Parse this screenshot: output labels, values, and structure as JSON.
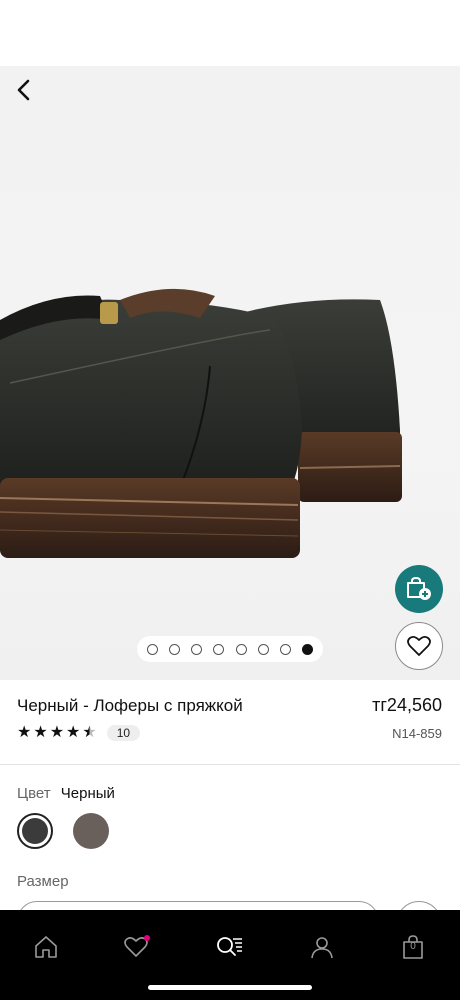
{
  "product": {
    "title": "Черный - Лоферы с пряжкой",
    "price": "тг24,560",
    "rating_count": "10",
    "sku": "N14-859",
    "rating": 4.5
  },
  "gallery": {
    "total_images": 8,
    "active_index": 8
  },
  "color": {
    "label": "Цвет",
    "selected": "Черный",
    "swatches": [
      "#3b3b3b",
      "#6a605b"
    ]
  },
  "size": {
    "label": "Размер"
  },
  "tabbar": {
    "cart_count": "0",
    "items": [
      "home-icon",
      "heart-icon",
      "search-list-icon",
      "profile-icon",
      "bag-icon"
    ]
  },
  "colors": {
    "accent": "#187a7a",
    "notification_dot": "#e6007e"
  }
}
